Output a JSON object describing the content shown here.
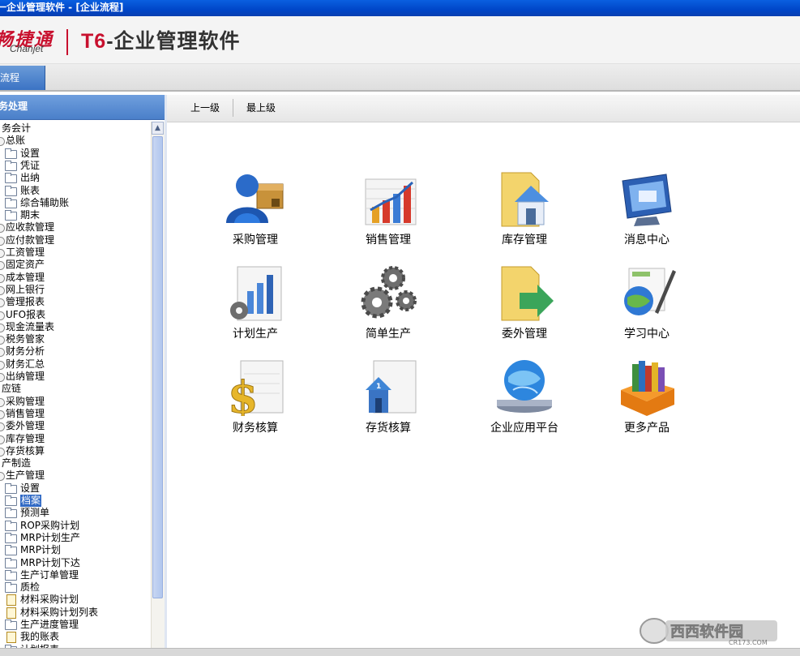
{
  "window": {
    "title": "一企业管理软件 - [企业流程]"
  },
  "brand": {
    "logo_cn": "畅捷通",
    "logo_en": "Chanjet",
    "product_prefix": "T6",
    "product_name": "-企业管理软件"
  },
  "tabs": [
    {
      "label": "流程",
      "active": true
    }
  ],
  "left_panel": {
    "header": "务处理",
    "tree": [
      {
        "label": "务会计",
        "type": "root",
        "indent": 0
      },
      {
        "label": "总账",
        "type": "module",
        "indent": 1
      },
      {
        "label": "设置",
        "type": "folder",
        "indent": 2
      },
      {
        "label": "凭证",
        "type": "folder",
        "indent": 2
      },
      {
        "label": "出纳",
        "type": "folder",
        "indent": 2
      },
      {
        "label": "账表",
        "type": "folder",
        "indent": 2
      },
      {
        "label": "综合辅助账",
        "type": "folder",
        "indent": 2
      },
      {
        "label": "期末",
        "type": "folder",
        "indent": 2
      },
      {
        "label": "应收款管理",
        "type": "module",
        "indent": 1
      },
      {
        "label": "应付款管理",
        "type": "module",
        "indent": 1
      },
      {
        "label": "工资管理",
        "type": "module",
        "indent": 1
      },
      {
        "label": "固定资产",
        "type": "module",
        "indent": 1
      },
      {
        "label": "成本管理",
        "type": "module",
        "indent": 1
      },
      {
        "label": "网上银行",
        "type": "module",
        "indent": 1
      },
      {
        "label": "管理报表",
        "type": "module",
        "indent": 1
      },
      {
        "label": "UFO报表",
        "type": "module",
        "indent": 1
      },
      {
        "label": "现金流量表",
        "type": "module",
        "indent": 1
      },
      {
        "label": "税务管家",
        "type": "module",
        "indent": 1
      },
      {
        "label": "财务分析",
        "type": "module",
        "indent": 1
      },
      {
        "label": "财务汇总",
        "type": "module",
        "indent": 1
      },
      {
        "label": "出纳管理",
        "type": "module",
        "indent": 1
      },
      {
        "label": "应链",
        "type": "root",
        "indent": 0
      },
      {
        "label": "采购管理",
        "type": "module",
        "indent": 1
      },
      {
        "label": "销售管理",
        "type": "module",
        "indent": 1
      },
      {
        "label": "委外管理",
        "type": "module",
        "indent": 1
      },
      {
        "label": "库存管理",
        "type": "module",
        "indent": 1
      },
      {
        "label": "存货核算",
        "type": "module",
        "indent": 1
      },
      {
        "label": "产制造",
        "type": "root",
        "indent": 0
      },
      {
        "label": "生产管理",
        "type": "module",
        "indent": 1
      },
      {
        "label": "设置",
        "type": "folder",
        "indent": 2
      },
      {
        "label": "档案",
        "type": "folder",
        "indent": 2,
        "selected": true
      },
      {
        "label": "预测单",
        "type": "folder",
        "indent": 2
      },
      {
        "label": "ROP采购计划",
        "type": "folder",
        "indent": 2
      },
      {
        "label": "MRP计划生产",
        "type": "folder",
        "indent": 2
      },
      {
        "label": "MRP计划",
        "type": "folder",
        "indent": 2
      },
      {
        "label": "MRP计划下达",
        "type": "folder",
        "indent": 2
      },
      {
        "label": "生产订单管理",
        "type": "folder",
        "indent": 2
      },
      {
        "label": "质检",
        "type": "folder",
        "indent": 2
      },
      {
        "label": "材料采购计划",
        "type": "doc",
        "indent": 2
      },
      {
        "label": "材料采购计划列表",
        "type": "doc",
        "indent": 2
      },
      {
        "label": "生产进度管理",
        "type": "folder",
        "indent": 2
      },
      {
        "label": "我的账表",
        "type": "doc",
        "indent": 2
      },
      {
        "label": "计划报表",
        "type": "folder",
        "indent": 2
      }
    ]
  },
  "toolbar": {
    "up_label": "上一级",
    "top_label": "最上级"
  },
  "apps": [
    {
      "label": "采购管理",
      "icon": "purchase-manager-icon"
    },
    {
      "label": "销售管理",
      "icon": "sales-chart-icon"
    },
    {
      "label": "库存管理",
      "icon": "inventory-house-icon"
    },
    {
      "label": "消息中心",
      "icon": "message-monitor-icon"
    },
    {
      "label": "计划生产",
      "icon": "planning-chart-gear-icon"
    },
    {
      "label": "简单生产",
      "icon": "gears-icon"
    },
    {
      "label": "委外管理",
      "icon": "outsource-folder-arrow-icon"
    },
    {
      "label": "学习中心",
      "icon": "learning-globe-pen-icon"
    },
    {
      "label": "财务核算",
      "icon": "finance-dollar-icon"
    },
    {
      "label": "存货核算",
      "icon": "stock-house-doc-icon"
    },
    {
      "label": "企业应用平台",
      "icon": "platform-globe-icon"
    },
    {
      "label": "更多产品",
      "icon": "more-products-books-icon"
    }
  ],
  "watermark": {
    "text": "西西软件园",
    "sub": "CR173.COM"
  }
}
